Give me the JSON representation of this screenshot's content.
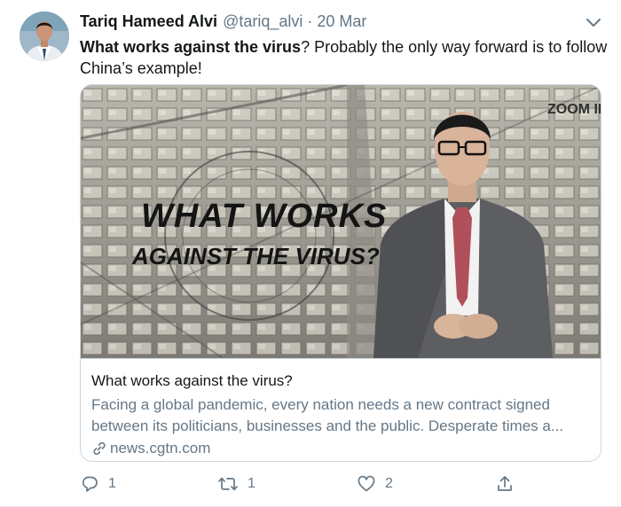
{
  "tweet": {
    "author_name": "Tariq Hameed Alvi",
    "handle": "@tariq_alvi",
    "separator": "·",
    "date": "20 Mar",
    "text_bold": "What works against the virus",
    "text_rest": "? Probably the only way forward is to follow China’s example!"
  },
  "card": {
    "image": {
      "overlay_line1": "WHAT WORKS",
      "overlay_line2": "AGAINST THE VIRUS?",
      "logo": "ZOOM IN"
    },
    "title": "What works against the virus?",
    "description": "Facing a global pandemic, every nation needs a new contract signed between its politicians, businesses and the public. Desperate times a...",
    "domain": "news.cgtn.com"
  },
  "actions": {
    "reply_count": "1",
    "retweet_count": "1",
    "like_count": "2"
  },
  "icons": [
    "chevron-down-icon",
    "link-icon",
    "reply-icon",
    "retweet-icon",
    "like-icon",
    "share-icon"
  ],
  "colors": {
    "text_primary": "#14171a",
    "text_secondary": "#657786",
    "border": "#ccd6dd"
  }
}
